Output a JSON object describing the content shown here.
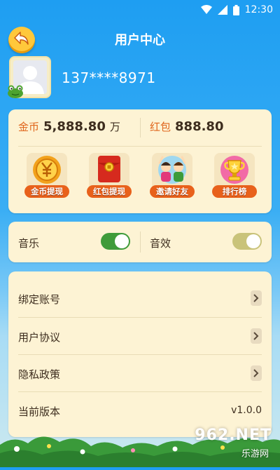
{
  "status_bar": {
    "time": "12:30",
    "icons": [
      "wifi-icon",
      "signal-icon",
      "battery-icon"
    ]
  },
  "header": {
    "title": "用户中心",
    "back_icon": "back-arrow-icon"
  },
  "profile": {
    "phone": "137****8971",
    "avatar_icon": "default-avatar-icon"
  },
  "balances": {
    "coins_label": "金币",
    "coins_value": "5,888.80",
    "coins_unit": "万",
    "redpacket_label": "红包",
    "redpacket_value": "888.80"
  },
  "actions": [
    {
      "label": "金币提现",
      "icon": "coin-yuan-icon"
    },
    {
      "label": "红包提现",
      "icon": "red-envelope-icon"
    },
    {
      "label": "邀请好友",
      "icon": "friends-icon"
    },
    {
      "label": "排行榜",
      "icon": "trophy-icon"
    }
  ],
  "settings": {
    "music_label": "音乐",
    "music_on": true,
    "sfx_label": "音效",
    "sfx_on": true
  },
  "menu": {
    "bind_account": "绑定账号",
    "user_agreement": "用户协议",
    "privacy_policy": "隐私政策",
    "version_label": "当前版本",
    "version_value": "v1.0.0"
  },
  "watermark": {
    "brand": "962.NET",
    "sub": "乐游网"
  },
  "colors": {
    "sky": "#1e9ef2",
    "card": "#fdf3d4",
    "accent_orange": "#e8611b",
    "toggle_green": "#3f9b3a",
    "toggle_khaki": "#c9c37a",
    "back_btn": "#ffc83b"
  }
}
